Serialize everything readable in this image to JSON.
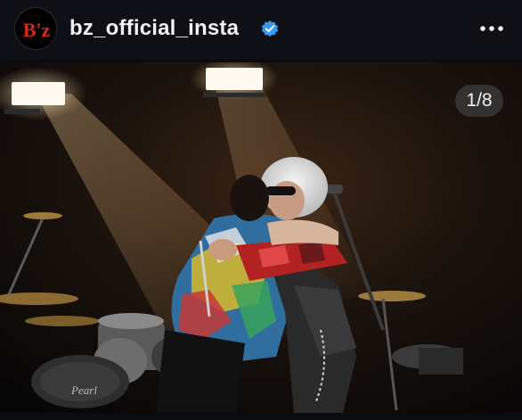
{
  "post": {
    "username": "bz_official_insta",
    "avatar_text": "B'z",
    "verified": true,
    "verified_icon": "verified-badge-icon",
    "more_icon": "more-options-icon",
    "accent_color": "#3897f0",
    "avatar_color": "#d8261c"
  },
  "media": {
    "counter": "1/8",
    "drum_brand": "Pearl",
    "description_icon": "concert-photo"
  }
}
